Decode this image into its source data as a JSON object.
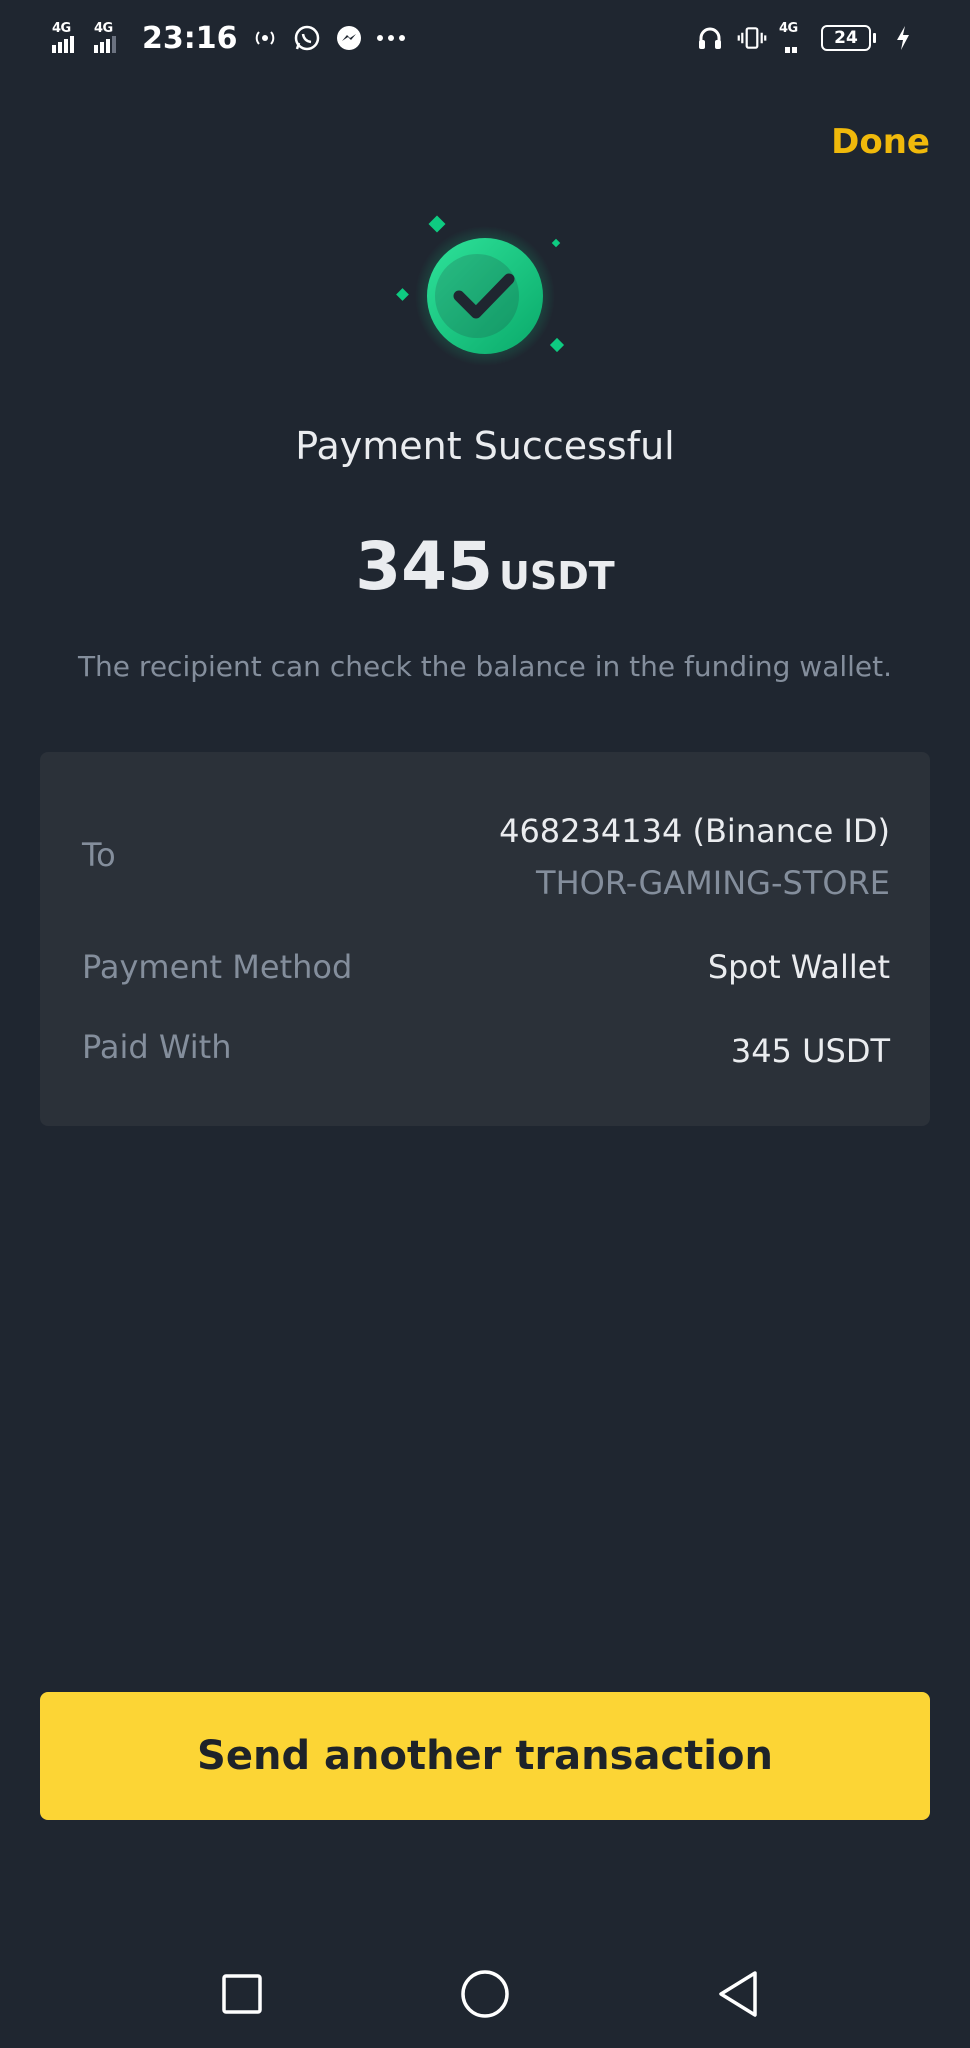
{
  "status_bar": {
    "network_left": [
      "4G",
      "4G"
    ],
    "time": "23:16",
    "network_right": "4G",
    "battery": "24"
  },
  "header": {
    "done_label": "Done"
  },
  "result": {
    "title": "Payment Successful",
    "amount": "345",
    "unit": "USDT",
    "note": "The recipient can check the balance in the funding wallet."
  },
  "details": {
    "to_label": "To",
    "to_value": "468234134 (Binance ID)",
    "to_subvalue": "THOR-GAMING-STORE",
    "method_label": "Payment Method",
    "method_value": "Spot Wallet",
    "paid_label": "Paid With",
    "paid_value": "345 USDT"
  },
  "actions": {
    "primary_label": "Send another transaction"
  },
  "colors": {
    "background": "#1f2630",
    "card": "#2b3139",
    "accent": "#f0b90b",
    "button": "#fcd535",
    "success": "#0ecb81",
    "muted_text": "#848e9c"
  },
  "icons": {
    "success": "check-circle-icon",
    "nav": [
      "recents-square-icon",
      "home-circle-icon",
      "back-triangle-icon"
    ]
  }
}
